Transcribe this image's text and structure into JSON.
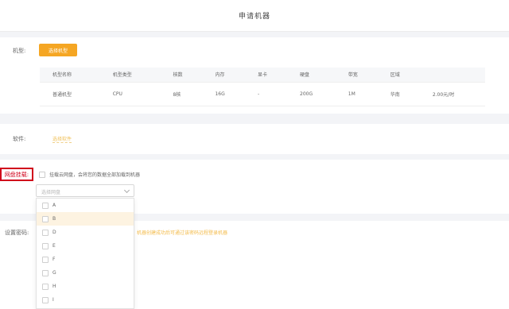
{
  "header": {
    "title": "申请机器"
  },
  "machine": {
    "label": "机型:",
    "select_button": "选择机型",
    "columns": [
      "机型名称",
      "机型类型",
      "核数",
      "内存",
      "显卡",
      "硬盘",
      "带宽",
      "区域"
    ],
    "row": [
      "普通机型",
      "CPU",
      "8核",
      "16G",
      "-",
      "200G",
      "1M",
      "华南"
    ],
    "price": "2.00元/时"
  },
  "software": {
    "label": "软件:",
    "link": "选择软件"
  },
  "cloud": {
    "label": "网盘挂载:",
    "checkbox_text": "挂载云网盘，会将您的数据全部加载到机器",
    "select_placeholder": "选择网盘"
  },
  "settings": {
    "label": "设置密码:",
    "note": "机器创建成功后可通过该密码远程登录机器"
  },
  "dropdown": {
    "items": [
      "A",
      "B",
      "D",
      "E",
      "F",
      "G",
      "H",
      "I"
    ],
    "active_index": 1
  }
}
